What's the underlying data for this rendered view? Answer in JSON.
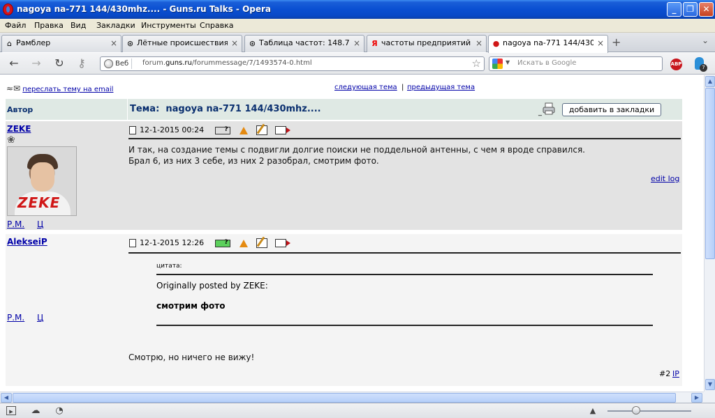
{
  "window": {
    "title": "nagoya na-771 144/430mhz.... - Guns.ru Talks - Opera",
    "min_label": "_",
    "max_label": "❐",
    "close_label": "✕"
  },
  "menu": [
    "Файл",
    "Правка",
    "Вид",
    "Закладки",
    "Инструменты",
    "Справка"
  ],
  "tabs": [
    {
      "label": "Рамблер",
      "icon": "home-icon",
      "active": false
    },
    {
      "label": "Лётные происшествия ...",
      "icon": "site-icon",
      "active": false
    },
    {
      "label": "Таблица частот: 148.7...",
      "icon": "site-icon",
      "active": false
    },
    {
      "label": "частоты предприятий ...",
      "icon": "yandex-icon",
      "active": false
    },
    {
      "label": "nagoya na-771 144/430...",
      "icon": "guns-icon",
      "active": true
    }
  ],
  "tab_icons": {
    "home": "⌂",
    "site": "⊛",
    "yandex": "Я",
    "guns": "●"
  },
  "new_tab_label": "+",
  "tab_menu_label": "⌄",
  "nav": {
    "back": "←",
    "forward": "→",
    "reload": "↻",
    "key": "⚷",
    "web_chip": "Веб",
    "url_prefix": "forum.",
    "url_domain": "guns.ru",
    "url_rest": "/forummessage/7/1493574-0.html",
    "star": "☆",
    "search_placeholder": "Искать в Google",
    "search_dropdown": "▼",
    "abp_label": "ABP",
    "badge_count": "7"
  },
  "page": {
    "forward_email": "переслать тему на email",
    "next_topic": "следующая тема",
    "prev_topic": "предыдущая тема",
    "nav_sep": "|",
    "author_header": "Автор",
    "topic_label": "Тема:",
    "topic_title": "nagoya na-771 144/430mhz....",
    "bookmark_button": "добавить в закладки",
    "bookmark_dot": "_",
    "posts": [
      {
        "author": "ZEKE",
        "date": "12-1-2015 00:24",
        "text_lines": [
          "И так, на создание темы с подвигли долгие поиски не поддельной антенны, с чем я вроде справился.",
          "Брал 6, из них 3 себе, из них 2 разобрал, смотрим фото."
        ],
        "edit_log": "edit log",
        "pm": "Р.М.",
        "c": "Ц",
        "avatar_text": "ZEKE"
      },
      {
        "author": "AlekseiP",
        "date": "12-1-2015 12:26",
        "quote_label": "цитата:",
        "quote_origin": "Originally posted by ZEKE:",
        "quote_text": "смотрим фото",
        "reply_text": "Смотрю, но ничего не вижу!",
        "post_number": "#2",
        "ip": "IP",
        "pm": "Р.М.",
        "c": "Ц"
      }
    ]
  },
  "status": {
    "icons": [
      "panel-icon",
      "cloud-icon",
      "speed-dial-icon"
    ]
  }
}
